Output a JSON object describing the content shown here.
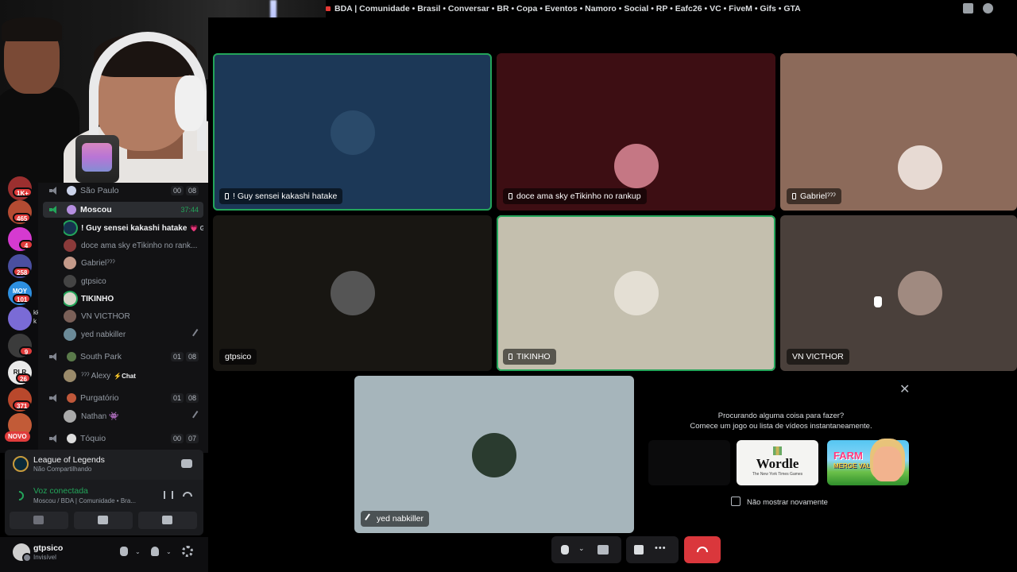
{
  "window": {
    "title": "BDA | Comunidade • Brasil • Conversar • BR • Copa • Eventos • Namoro • Social • RP • Eafc26 • VC • FiveM • Gifs • GTA",
    "icons": [
      "inbox-icon",
      "help-icon"
    ]
  },
  "servers": [
    {
      "badge": "1K+",
      "color": "#9b2f2f"
    },
    {
      "badge": "465",
      "color": "#b44b32"
    },
    {
      "badge": "4",
      "color": "#d53ad0"
    },
    {
      "badge": "258",
      "color": "#4a4fa0"
    },
    {
      "badge": "101",
      "color": "#2d8fe0",
      "text": "MOY"
    },
    {
      "badge": "",
      "color": "#7a6bd6"
    },
    {
      "badge": "9",
      "color": "#3b3b3b"
    },
    {
      "badge": "26",
      "color": "#e9e9e9",
      "text": "RLR"
    },
    {
      "badge": "371",
      "color": "#b9482c"
    },
    {
      "badge": "",
      "color": "#c25b37"
    }
  ],
  "rail": {
    "novo_label": "NOVO",
    "unread_snippet_1": "kkkk",
    "unread_snippet_2": "k"
  },
  "channels": [
    {
      "name": "São Paulo",
      "count": [
        "00",
        "08"
      ],
      "active": false
    },
    {
      "name": "Moscou",
      "time": "37:44",
      "active": true
    },
    {
      "name": "South Park",
      "count": [
        "01",
        "08"
      ],
      "active": false
    },
    {
      "name": "Purgatório",
      "count": [
        "01",
        "08"
      ],
      "active": false
    },
    {
      "name": "Tóquio",
      "count": [
        "00",
        "07"
      ],
      "active": false
    }
  ],
  "members": [
    {
      "name": "! Guy sensei kakashi hatake",
      "tag": "💗 GO",
      "bright": true,
      "speaking": true
    },
    {
      "name": "doce ama sky eTikinho no rank...",
      "bright": false
    },
    {
      "name": "Gabrielˀˀˀ",
      "bright": false
    },
    {
      "name": "gtpsico",
      "bright": false
    },
    {
      "name": "TIKINHO",
      "bright": true,
      "speaking": true
    },
    {
      "name": "VN VICTHOR",
      "bright": false
    },
    {
      "name": "yed nabkiller",
      "bright": false,
      "muted": true
    }
  ],
  "southpark_members": [
    {
      "name": "ˀˀˀ Alexy",
      "chat": "⚡Chat"
    }
  ],
  "purgatorio_members": [
    {
      "name": "Nathan 👾"
    }
  ],
  "activity": {
    "game": "League of Legends",
    "status": "Não Compartilhando"
  },
  "voice": {
    "status": "Voz conectada",
    "location": "Moscou / BDA | Comunidade • Bra..."
  },
  "user": {
    "name": "gtpsico",
    "status": "Invisível"
  },
  "tiles": [
    {
      "label": "! Guy sensei kakashi hatake",
      "phone": true
    },
    {
      "label": "doce ama sky eTikinho no rankup",
      "phone": true
    },
    {
      "label": "Gabrielˀˀˀ",
      "phone": true
    },
    {
      "label": "gtpsico",
      "phone": false
    },
    {
      "label": "TIKINHO",
      "phone": true
    },
    {
      "label": "VN VICTHOR",
      "phone": false
    },
    {
      "label": "yed nabkiller",
      "muted": true
    }
  ],
  "suggestion": {
    "line1": "Procurando alguma coisa para fazer?",
    "line2": "Comece um jogo ou lista de vídeos instantaneamente.",
    "wordle_title": "Wordle",
    "wordle_sub": "The New York Times Games",
    "farm_title": "FARM",
    "farm_sub": "MERGE VALLEY",
    "dont_show": "Não mostrar novamente"
  },
  "colors": {
    "speaking": "#23a55a",
    "hangup": "#da373c",
    "badge": "#e03b3b"
  }
}
